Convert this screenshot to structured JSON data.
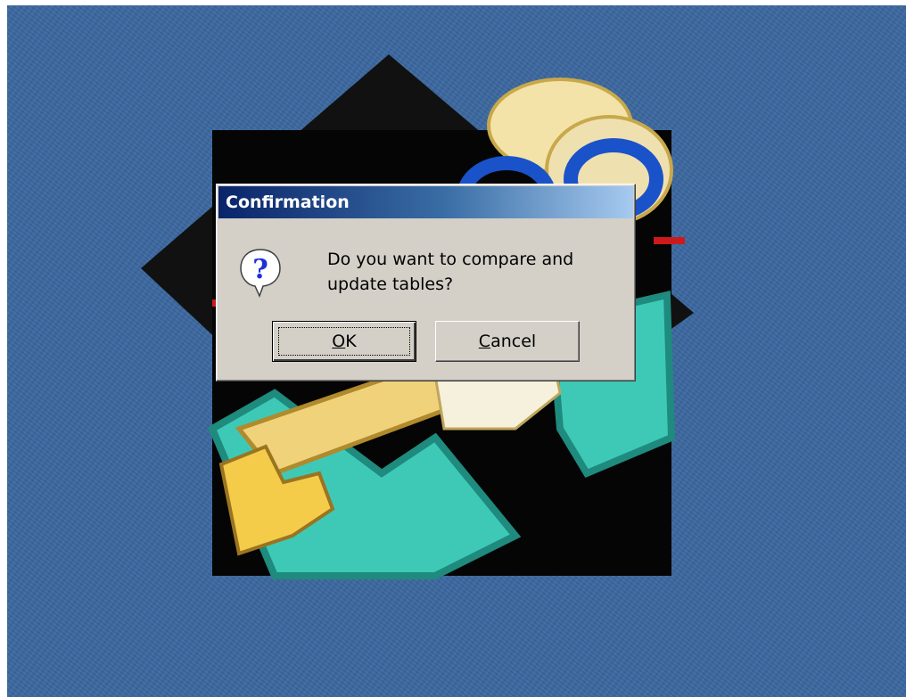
{
  "dialog": {
    "title": "Confirmation",
    "message": "Do you want to compare and update tables?",
    "icon": "question-icon",
    "buttons": {
      "ok": {
        "accel": "O",
        "rest": "K"
      },
      "cancel": {
        "accel": "C",
        "rest": "ancel"
      }
    }
  },
  "colors": {
    "desktop": "#3b68a0",
    "dialog_face": "#d4d0c8",
    "titlebar_start": "#0a246a",
    "titlebar_end": "#a6caf0"
  }
}
